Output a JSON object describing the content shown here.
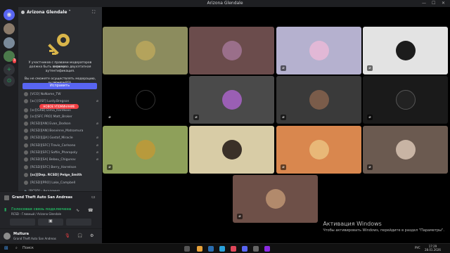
{
  "window": {
    "title": "Arizona Glendale"
  },
  "server": {
    "name": "Arizona Glendale"
  },
  "mfa": {
    "line1": "У участников с правами модераторов сервера",
    "line2": "должна быть включена двухэтапная",
    "line3": "аутентификация.",
    "line4": "Вы не сможете осуществлять модерацию, пока не",
    "line5": "включите 2FA.",
    "fix_label": "Исправить"
  },
  "mentions_badge": "НОВОЕ УПОМИНАНИЕ",
  "members": [
    "[VCO] NoName_TW",
    "[ac] [OSF] Lusty.Bregson",
    "[sc][GRB] Dima_Rantkoos",
    "[sc][SFC PRO] Matt_Broker",
    "[RCSD][AN] Evan_Dodson",
    "[RCSD][AN] Bosvinne_Matsamura",
    "[RCSD][ДА] Gostaf_Miracle",
    "[RCSD][SFC] Travis_Carlsono",
    "[RCSD][SFC] Softin_Pharopoly",
    "[RCSD][SA] Bebou_Chigunov",
    "[RCSD][SFC] Berry_Harrelson",
    "[sc][Dep. RCSD] Pelge_Smith",
    "[RCSD][PRO] Lake_Campbell",
    "[RCSD] - Академия"
  ],
  "activity": {
    "game": "Grand Theft Auto San Andreas"
  },
  "voice": {
    "status": "Голосовая связь подключена",
    "channel": "RCSD - Главный / Arizona Glendale"
  },
  "user": {
    "name": "Multura",
    "status": "Grand Theft Auto San Andreas"
  },
  "taskbar": {
    "search": "Поиск",
    "lang": "РУС",
    "time": "17:29",
    "date": "28.01.2026"
  },
  "activation": {
    "title": "Активация Windows",
    "subtitle": "Чтобы активировать Windows, перейдите в раздел \"Параметры\"."
  },
  "colors": {
    "accent": "#5865f2",
    "sidebar": "#2b2d31",
    "danger": "#f23f43"
  }
}
